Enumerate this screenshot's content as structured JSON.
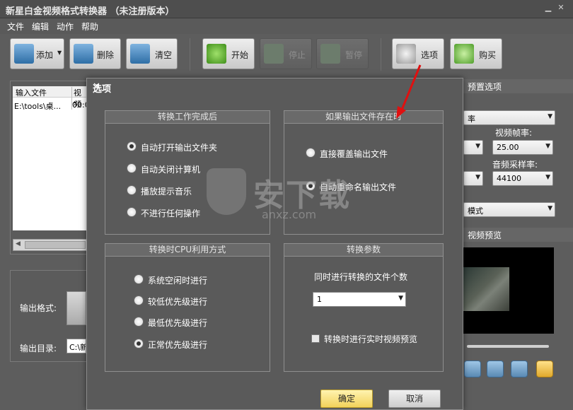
{
  "window": {
    "title": "新星白金视频格式转换器 （未注册版本）"
  },
  "menu": [
    "文件",
    "编辑",
    "动作",
    "帮助"
  ],
  "toolbar": {
    "add": "添加",
    "delete": "删除",
    "clear": "清空",
    "start": "开始",
    "stop": "停止",
    "pause": "暂停",
    "options": "选项",
    "buy": "购买"
  },
  "filelist": {
    "col1": "输入文件",
    "col2": "视频",
    "row1_file": "E:\\tools\\桌...",
    "row1_dur": "00:0"
  },
  "right_panel": {
    "preset_header": "预置选项",
    "preset_value": "率",
    "fps_label": "视频帧率:",
    "fps_value": "25.00",
    "sample_label": "音频采样率:",
    "sample_value": "44100",
    "mode_value": "模式",
    "preview_header": "视频预览"
  },
  "bottom": {
    "format_label": "输出格式:",
    "dir_label": "输出目录:",
    "dir_value": "C:\\新"
  },
  "dialog": {
    "title": "选项",
    "group_done": {
      "title": "转换工作完成后",
      "options": [
        "自动打开输出文件夹",
        "自动关闭计算机",
        "播放提示音乐",
        "不进行任何操作"
      ],
      "selected": 0
    },
    "group_exists": {
      "title": "如果输出文件存在时",
      "options": [
        "直接覆盖输出文件",
        "自动重命名输出文件"
      ],
      "selected": 1
    },
    "group_cpu": {
      "title": "转换时CPU利用方式",
      "options": [
        "系统空闲时进行",
        "较低优先级进行",
        "最低优先级进行",
        "正常优先级进行"
      ],
      "selected": 3
    },
    "group_params": {
      "title": "转换参数",
      "concurrent_label": "同时进行转换的文件个数",
      "concurrent_value": "1",
      "preview_label": "转换时进行实时视频预览",
      "preview_checked": false
    },
    "ok": "确定",
    "cancel": "取消"
  },
  "watermark": {
    "text1": "安下载",
    "text2": "anxz.com"
  }
}
